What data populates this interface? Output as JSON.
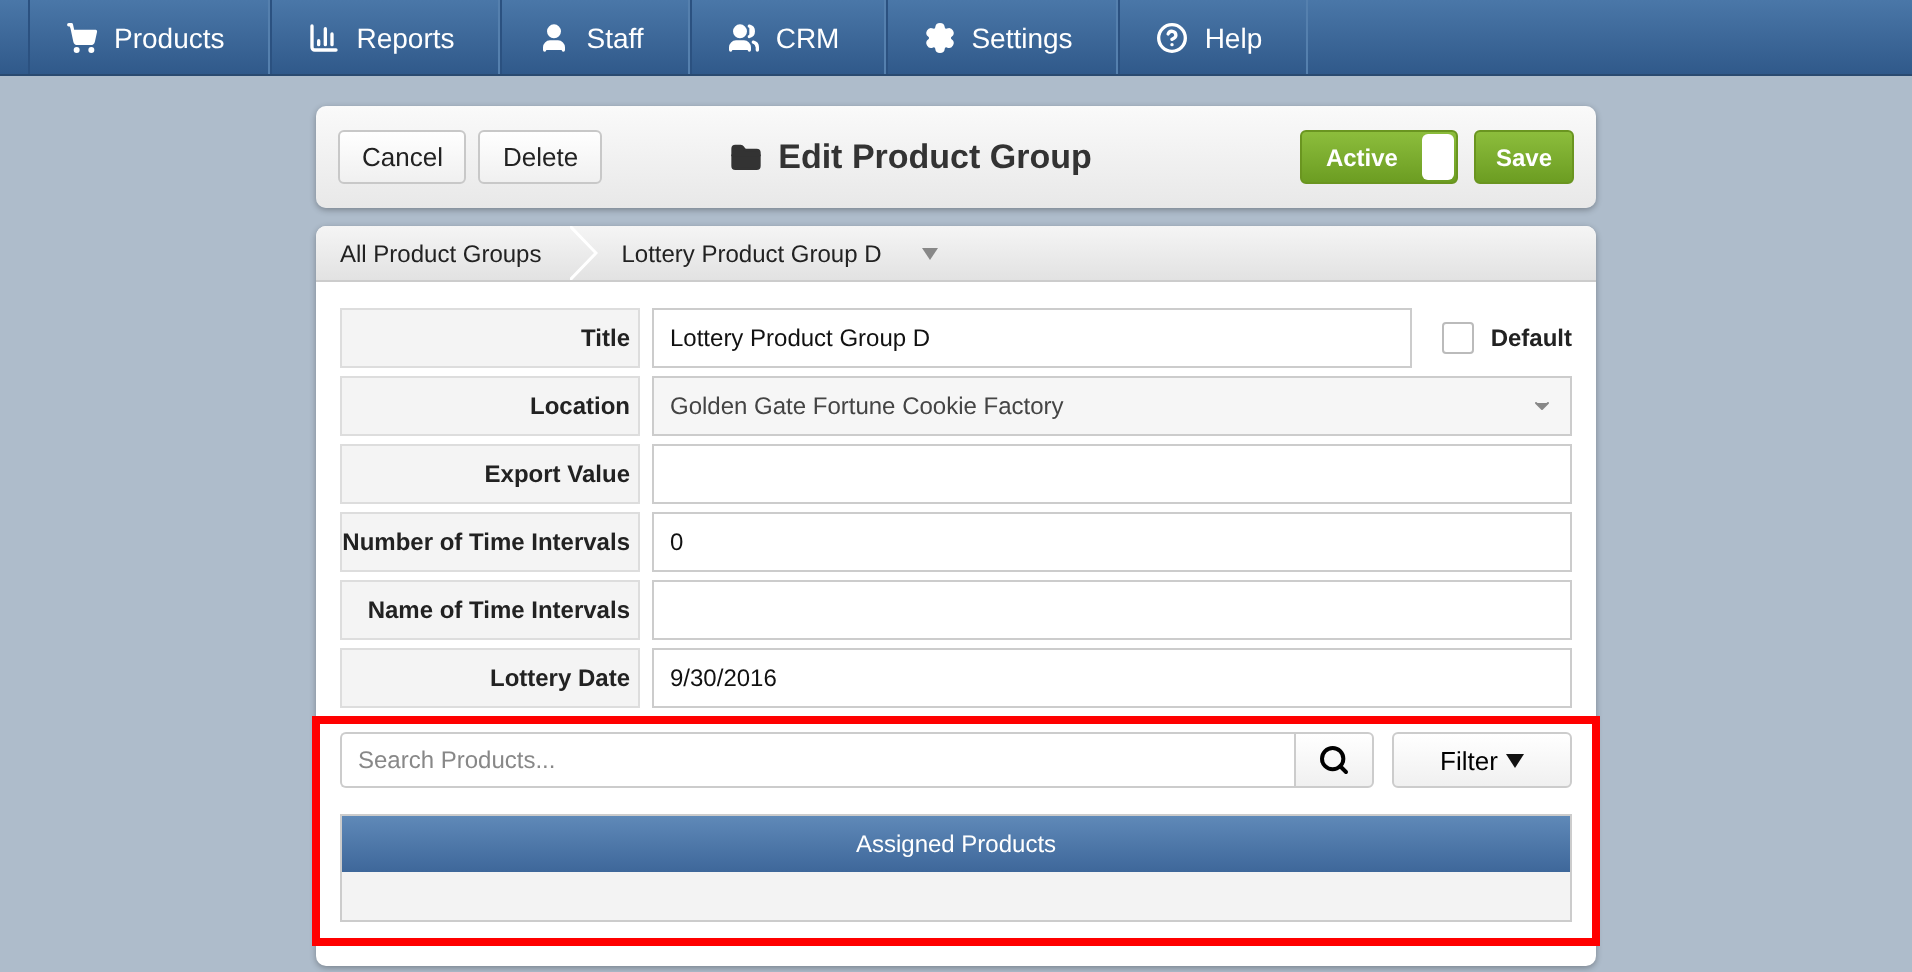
{
  "nav": [
    {
      "label": "Products"
    },
    {
      "label": "Reports"
    },
    {
      "label": "Staff"
    },
    {
      "label": "CRM"
    },
    {
      "label": "Settings"
    },
    {
      "label": "Help"
    }
  ],
  "header": {
    "buttons": [
      "Cancel",
      "Delete"
    ],
    "title": "Edit Product Group",
    "toggle": {
      "label": "Active",
      "on": true
    },
    "save": "Save"
  },
  "breadcrumb": [
    "All Product Groups",
    "Lottery Product Group D"
  ],
  "fields": [
    {
      "label": "Title",
      "kind": "text",
      "value": "Lottery Product Group D",
      "checkbox": {
        "label": "Default",
        "checked": false
      }
    },
    {
      "label": "Location",
      "kind": "select",
      "value": "Golden Gate Fortune Cookie Factory"
    },
    {
      "label": "Export Value",
      "kind": "text"
    },
    {
      "label": "Number of Time Intervals",
      "kind": "text",
      "value": "0"
    },
    {
      "label": "Name of Time Intervals",
      "kind": "text"
    },
    {
      "label": "Lottery Date",
      "kind": "text",
      "value": "9/30/2016"
    }
  ],
  "search": {
    "placeholder": "Search Products...",
    "filter": "Filter"
  },
  "table": {
    "columns": [
      "Assigned Products"
    ]
  },
  "highlight": true
}
